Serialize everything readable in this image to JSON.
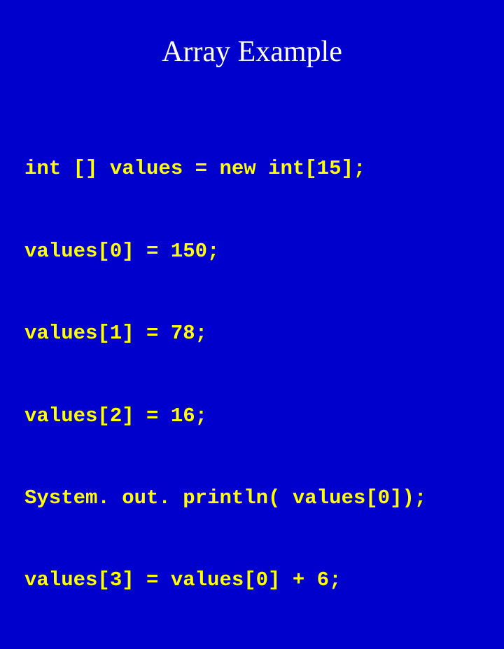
{
  "slide": {
    "title": "Array Example",
    "code": {
      "line1": "int [] values = new int[15];",
      "line2": "values[0] = 150;",
      "line3": "values[1] = 78;",
      "line4": "values[2] = 16;",
      "line5": "System. out. println( values[0]);",
      "line6": "values[3] = values[0] + 6;"
    }
  }
}
